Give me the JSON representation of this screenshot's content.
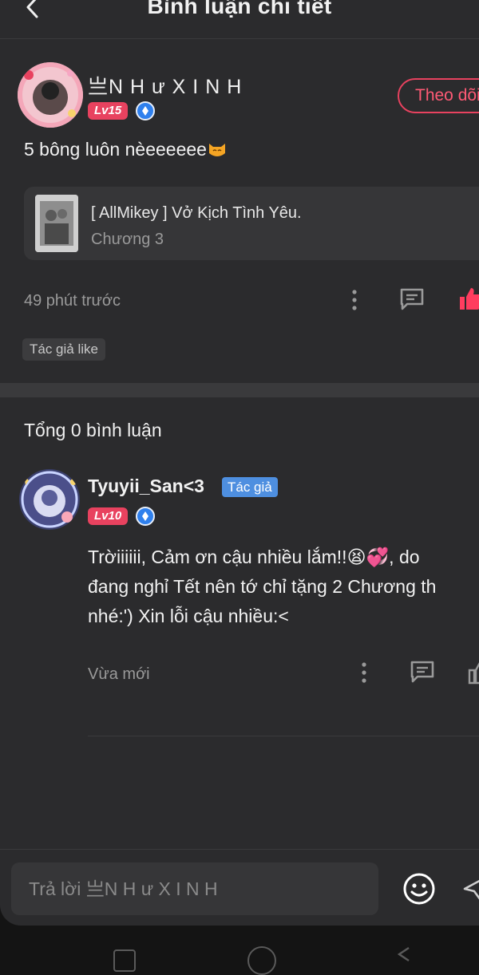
{
  "header": {
    "title": "Bình luận chi tiết"
  },
  "comment": {
    "username": "亗N H ư X I N H",
    "level": "Lv15",
    "follow_label": "Theo dõi",
    "text": "5 bông luôn nèeeeeee",
    "story": {
      "title": "[ AllMikey ] Vở Kịch Tình Yêu.",
      "chapter": "Chương 3"
    },
    "time": "49 phút trước",
    "author_liked": "Tác giả like"
  },
  "total_replies": "Tổng 0 bình luận",
  "reply": {
    "username": "Tyuyii_San<3",
    "author_badge": "Tác giả",
    "level": "Lv10",
    "text": "Trờiiiiii, Cảm ơn cậu nhiều lắm!!😫💞, do\nđang nghỉ Tết nên tớ chỉ tặng 2 Chương th\nnhé:') Xin lỗi cậu nhiều:<",
    "time": "Vừa mới"
  },
  "input": {
    "placeholder": "Trả lời 亗N H ư X I N H"
  },
  "colors": {
    "background": "#2b2b2d",
    "accent": "#e8425f",
    "author_badge": "#4e8fe0"
  }
}
